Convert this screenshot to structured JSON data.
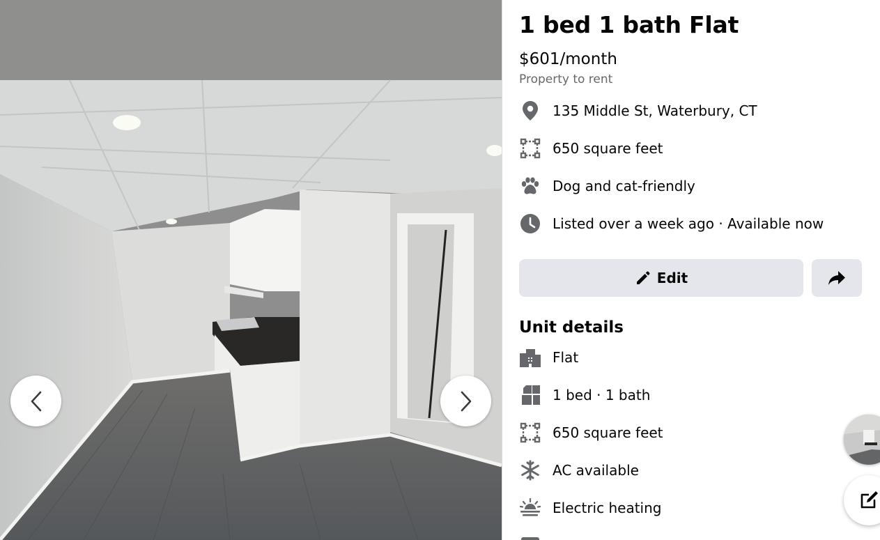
{
  "listing": {
    "title": "1 bed 1 bath Flat",
    "price": "$601/month",
    "subtitle": "Property to rent"
  },
  "summary_rows": [
    {
      "icon": "location-pin-icon",
      "text": "135 Middle St, Waterbury, CT"
    },
    {
      "icon": "floor-area-icon",
      "text": "650 square feet"
    },
    {
      "icon": "paw-icon",
      "text": "Dog and cat-friendly"
    },
    {
      "icon": "clock-icon",
      "text": "Listed over a week ago · Available now"
    }
  ],
  "actions": {
    "edit_label": "Edit",
    "edit_icon": "pencil-icon",
    "share_icon": "share-arrow-icon"
  },
  "unit_details": {
    "heading": "Unit details",
    "rows": [
      {
        "icon": "building-icon",
        "text": "Flat"
      },
      {
        "icon": "rooms-icon",
        "text": "1 bed · 1 bath"
      },
      {
        "icon": "floor-area-icon",
        "text": "650 square feet"
      },
      {
        "icon": "snowflake-icon",
        "text": "AC available"
      },
      {
        "icon": "heating-icon",
        "text": "Electric heating"
      }
    ]
  },
  "gallery": {
    "prev_icon": "chevron-left-icon",
    "next_icon": "chevron-right-icon"
  },
  "floating": {
    "thumbnail": "chat-thumbnail-avatar",
    "compose_icon": "compose-message-icon"
  },
  "colors": {
    "icon_gray": "#65676b",
    "button_bg": "#e4e6eb",
    "text_primary": "#050505",
    "text_secondary": "#65676b"
  }
}
